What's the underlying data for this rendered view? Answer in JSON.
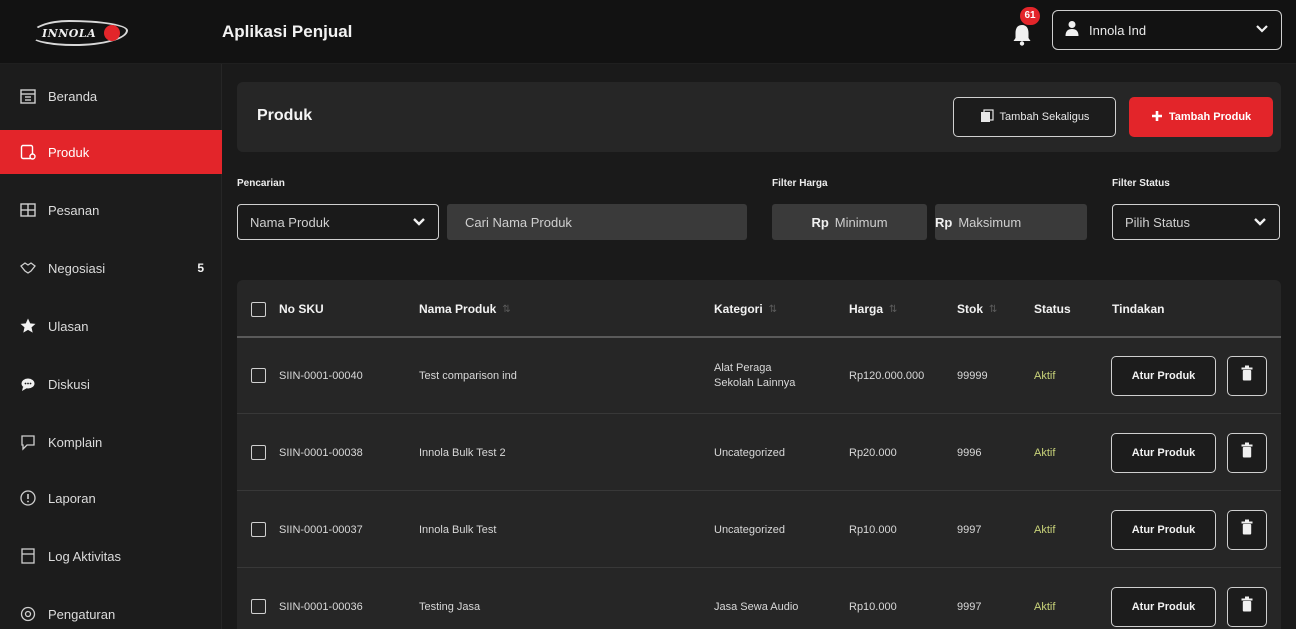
{
  "header": {
    "app_title": "Aplikasi Penjual",
    "logo_text": "INNOLA",
    "notification_count": "61",
    "user_name": "Innola Ind",
    "accent_color": "#e3252a"
  },
  "sidebar": {
    "items": [
      {
        "label": "Beranda",
        "icon": "home-icon"
      },
      {
        "label": "Produk",
        "icon": "product-icon",
        "active": true
      },
      {
        "label": "Pesanan",
        "icon": "order-icon"
      },
      {
        "label": "Negosiasi",
        "icon": "handshake-icon",
        "count": "5"
      },
      {
        "label": "Ulasan",
        "icon": "star-icon"
      },
      {
        "label": "Diskusi",
        "icon": "chat-icon"
      },
      {
        "label": "Komplain",
        "icon": "complaint-icon"
      },
      {
        "label": "Laporan",
        "icon": "report-icon"
      },
      {
        "label": "Log Aktivitas",
        "icon": "log-icon"
      },
      {
        "label": "Pengaturan",
        "icon": "gear-icon"
      }
    ]
  },
  "page": {
    "title": "Produk",
    "bulk_add_label": "Tambah Sekaligus",
    "add_label": "Tambah Produk"
  },
  "filters": {
    "search_label": "Pencarian",
    "search_type": "Nama Produk",
    "search_placeholder": "Cari Nama Produk",
    "price_label": "Filter Harga",
    "currency": "Rp",
    "min_placeholder": "Minimum",
    "max_placeholder": "Maksimum",
    "status_label": "Filter Status",
    "status_placeholder": "Pilih Status"
  },
  "table": {
    "columns": [
      "No SKU",
      "Nama Produk",
      "Kategori",
      "Harga",
      "Stok",
      "Status",
      "Tindakan"
    ],
    "action_label": "Atur Produk",
    "rows": [
      {
        "sku": "SIIN-0001-00040",
        "name": "Test comparison ind",
        "category": "Alat Peraga Sekolah Lainnya",
        "price": "Rp120.000.000",
        "stock": "99999",
        "status": "Aktif"
      },
      {
        "sku": "SIIN-0001-00038",
        "name": "Innola Bulk Test 2",
        "category": "Uncategorized",
        "price": "Rp20.000",
        "stock": "9996",
        "status": "Aktif"
      },
      {
        "sku": "SIIN-0001-00037",
        "name": "Innola Bulk Test",
        "category": "Uncategorized",
        "price": "Rp10.000",
        "stock": "9997",
        "status": "Aktif"
      },
      {
        "sku": "SIIN-0001-00036",
        "name": "Testing Jasa",
        "category": "Jasa Sewa Audio",
        "price": "Rp10.000",
        "stock": "9997",
        "status": "Aktif"
      }
    ]
  }
}
